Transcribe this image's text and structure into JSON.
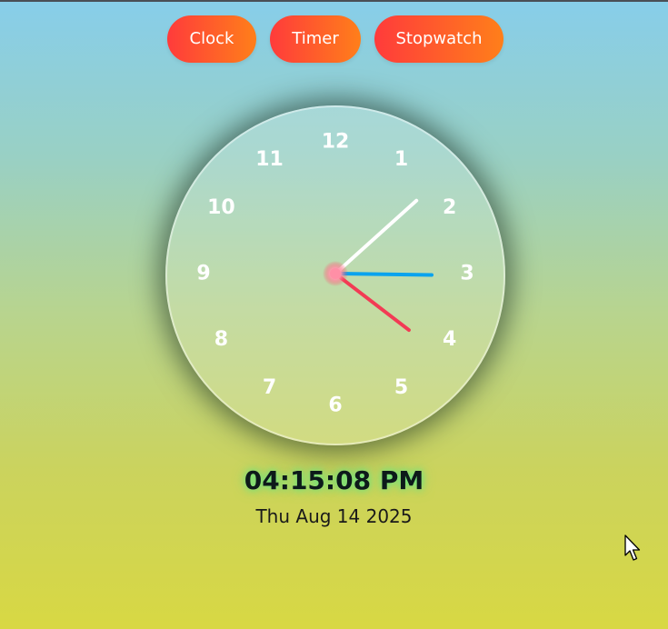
{
  "nav": {
    "clock_label": "Clock",
    "timer_label": "Timer",
    "stopwatch_label": "Stopwatch"
  },
  "clock": {
    "numbers": [
      "12",
      "1",
      "2",
      "3",
      "4",
      "5",
      "6",
      "7",
      "8",
      "9",
      "10",
      "11"
    ],
    "hour": 4,
    "minute": 15,
    "second": 8,
    "hour_hand_color": "#f23b54",
    "minute_hand_color": "#0aa3ee",
    "second_hand_color": "#ffffff",
    "center_color": "#ff8fa6"
  },
  "display": {
    "time": "04:15:08 PM",
    "date": "Thu Aug 14 2025"
  },
  "colors": {
    "button_gradient_start": "#ff3b3b",
    "button_gradient_end": "#ff7f1a",
    "time_glow": "#5ae682"
  }
}
